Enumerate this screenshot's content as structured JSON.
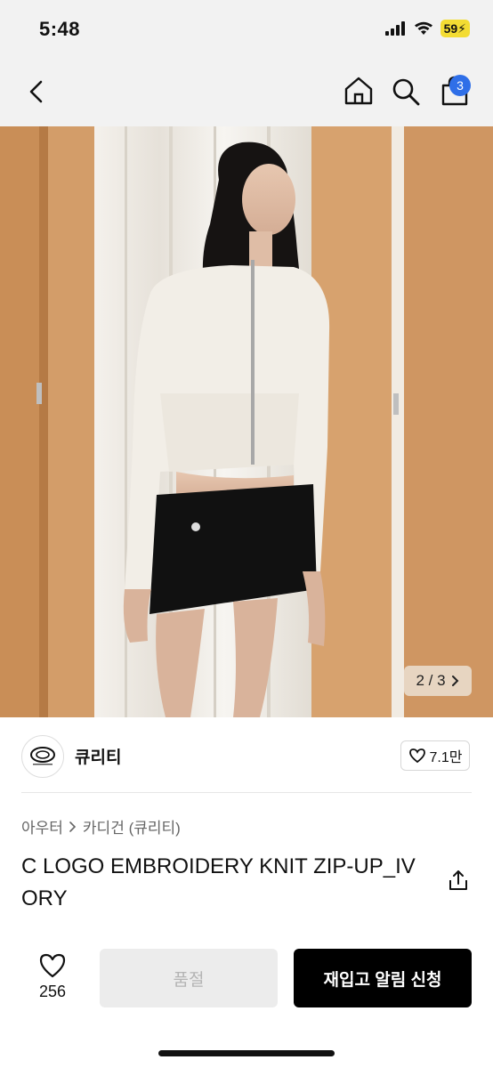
{
  "status_bar": {
    "time": "5:48",
    "battery": "59"
  },
  "nav": {
    "cart_count": "3"
  },
  "hero": {
    "counter": "2 / 3"
  },
  "brand": {
    "name": "큐리티",
    "likes": "7.1만"
  },
  "breadcrumb": {
    "level1": "아우터",
    "level2": "카디건 (큐리티)"
  },
  "product": {
    "title": "C LOGO EMBROIDERY KNIT ZIP-UP_IVORY"
  },
  "bottom": {
    "wish_count": "256",
    "soldout_label": "품절",
    "restock_label": "재입고 알림 신청"
  },
  "colors": {
    "accent_badge": "#2f6fe8",
    "primary_button": "#000000",
    "disabled_button": "#ececec"
  },
  "icons": [
    "back-icon",
    "home-icon",
    "search-icon",
    "shopping-bag-icon",
    "chevron-right-icon",
    "heart-icon",
    "share-icon",
    "signal-icon",
    "wifi-icon"
  ]
}
